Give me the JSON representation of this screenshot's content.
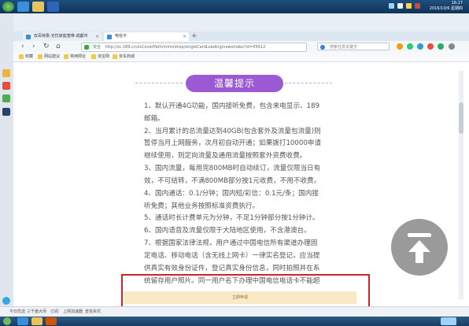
{
  "system": {
    "clock": "16:17",
    "date": "2016/10/6 星期四"
  },
  "tabs": [
    {
      "label": "双百特惠-无忧家庭宽带-成都市",
      "active": false
    },
    {
      "label": "电信卡",
      "active": true
    }
  ],
  "browser": {
    "new_tab_label": "+",
    "safe_label": "安全",
    "url": "http://sc.189.cn/zxCoverPath/mimi/shop/singleCardLoading/newsIndex?id=05612",
    "search_placeholder": "搜索任意关键字"
  },
  "bookmarks": [
    "收藏",
    "网站建议",
    "常用网址",
    "淘宝网",
    "京东商城"
  ],
  "content": {
    "tip_title": "温馨提示",
    "tips": [
      "1、默认开通4G功能，国内接听免费，包含来电显示、189",
      "邮箱。",
      "2、当月累计的总流量达到40GB(包含套外及流量包流量)则",
      "暂停当月上网服务，次月初自动开通；如果拨打10000申请",
      "继续使用，则定向流量及通用流量按照套外资费收费。",
      "3、国内流量，每用完800MB时自动续订，流量仅限当日有",
      "效，不可结转，不满800MB部分按1元收费，不用不收费。",
      "4、国内通话：0.1/分钟；国内短/彩信：0.1元/条；国内接",
      "听免费；其他业务按照标准资费执行。",
      "5、通话时长计费单元为分钟，不足1分钟部分按1分钟计。",
      "6、国内语音及流量仅限于大陆地区使用，不含港澳台。",
      "7、根据国家法律法规，用户通过中国电信所有渠道办理固",
      "定电话、移动电话（含无线上网卡）一律实名登记，应当提",
      "供真实有效身份证件，登记真实身份信息，同时拍照并在系",
      "统留存用户照片。同一用户名下办理中国电信电话卡不能超"
    ],
    "apply_label": "立即申请"
  },
  "status_bar": [
    "今日优选",
    "三千盘大师",
    "订阅",
    "上网加速器",
    "查找资讯"
  ],
  "colors": {
    "accent_purple": "#9b5ad3",
    "highlight_red": "#d12424",
    "apply_bg": "#fae9c6"
  }
}
